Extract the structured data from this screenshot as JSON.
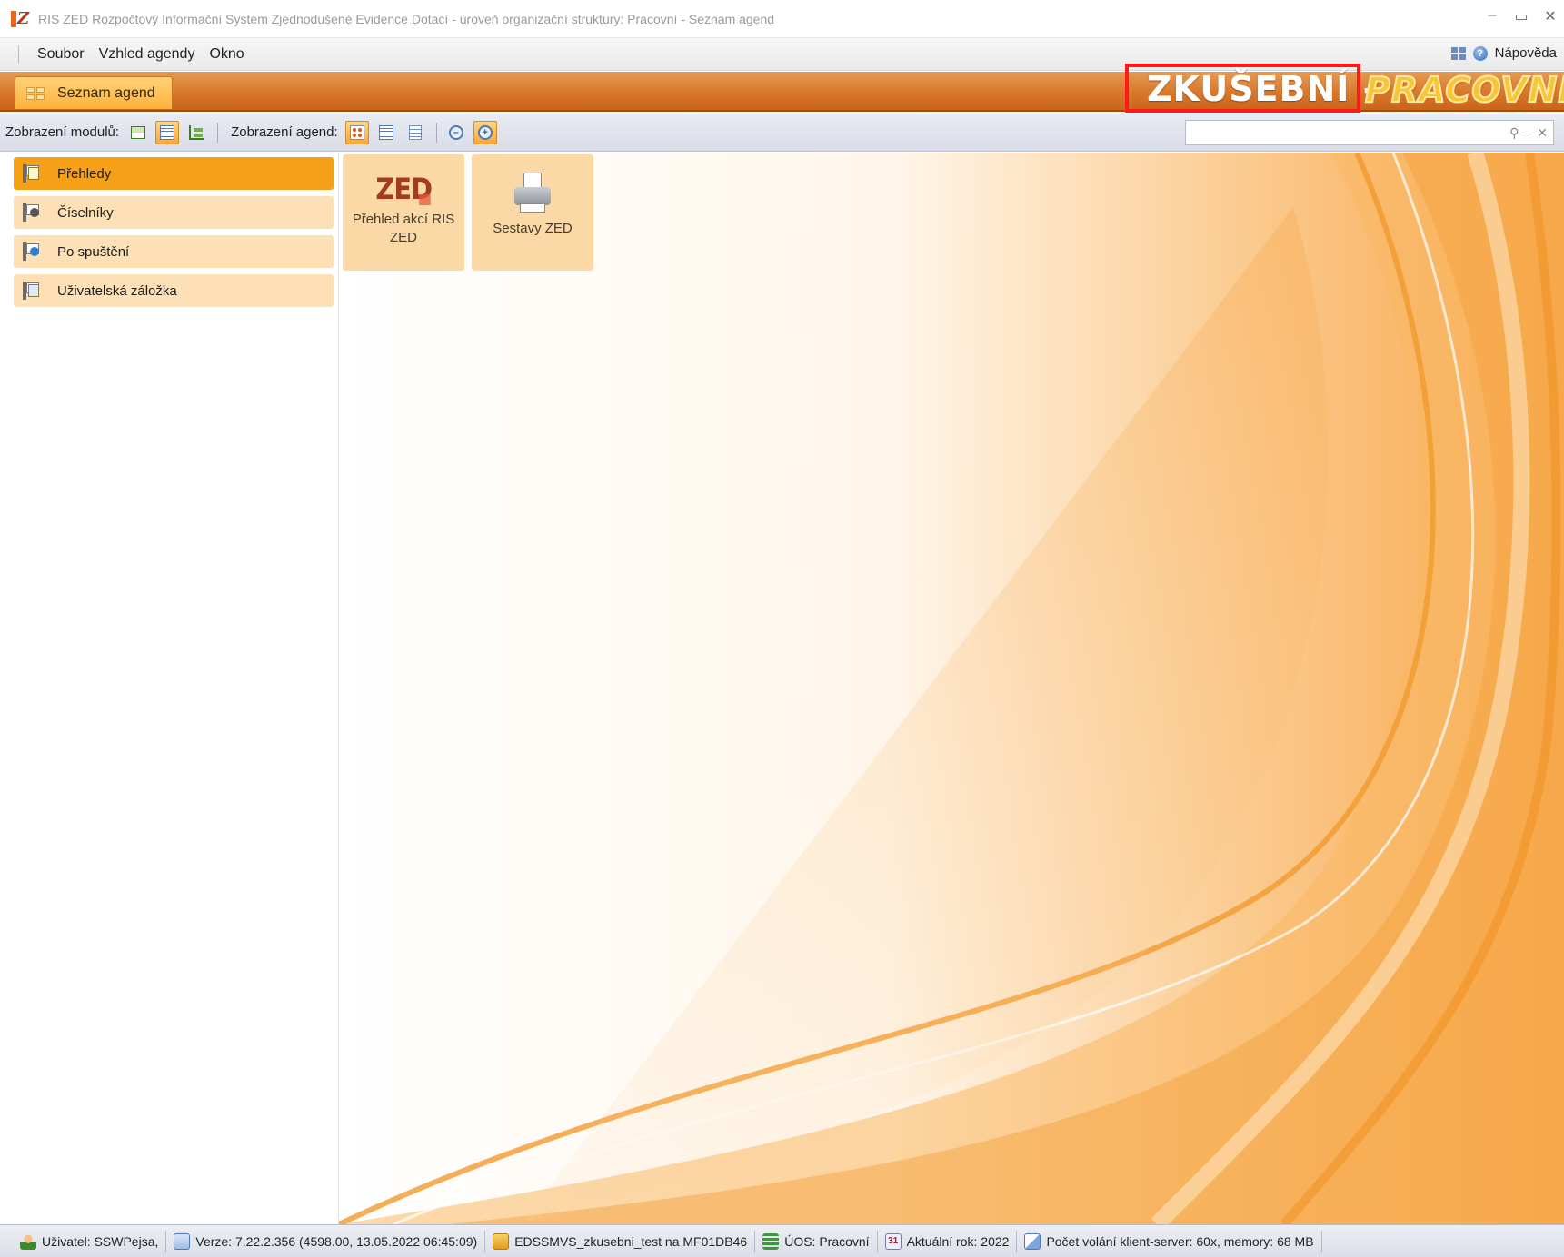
{
  "window": {
    "title": "RIS ZED Rozpočtový Informační Systém Zjednodušené Evidence Dotací - úroveň organizační struktury: Pracovní - Seznam agend",
    "controls": [
      "–",
      "▭",
      "✕"
    ]
  },
  "menu": {
    "items": [
      "Soubor",
      "Vzhled agendy",
      "Okno"
    ],
    "help_label": "Nápověda"
  },
  "tabs": {
    "active_label": "Seznam agend"
  },
  "environment": {
    "label": "ZKUŠEBNÍ -",
    "mode": "PRACOVNÍ",
    "badge_color": "#ff1a1a"
  },
  "toolbar": {
    "modules_label": "Zobrazení modulů:",
    "agendas_label": "Zobrazení agend:",
    "search_value": "",
    "search_clear": "✕",
    "search_minus": "–",
    "zoom_out": "–",
    "zoom_in": "+"
  },
  "sidebar": {
    "items": [
      {
        "label": "Přehledy",
        "icon": "flag-doc-icon",
        "active": true
      },
      {
        "label": "Číselníky",
        "icon": "flag-gear-icon",
        "active": false
      },
      {
        "label": "Po spuštění",
        "icon": "flag-blue-gear-icon",
        "active": false
      },
      {
        "label": "Uživatelská záložka",
        "icon": "flag-user-doc-icon",
        "active": false
      }
    ]
  },
  "tiles": [
    {
      "label": "Přehled akcí RIS ZED",
      "logo": "ZED",
      "icon": "zed-logo-icon"
    },
    {
      "label": "Sestavy ZED",
      "icon": "printer-icon"
    }
  ],
  "status": {
    "user": "Uživatel: SSWPejsa,",
    "version": "Verze: 7.22.2.356 (4598.00, 13.05.2022 06:45:09)",
    "database": "EDSSMVS_zkusebni_test na MF01DB46",
    "uos": "ÚOS: Pracovní",
    "year_icon": "31",
    "year": "Aktuální rok: 2022",
    "calls": "Počet volání klient-server: 60x, memory: 68 MB"
  },
  "colors": {
    "accent_orange": "#f5a016",
    "band_orange": "#d7782c",
    "tile_bg": "#fbd9a6",
    "nav_bg": "#fde0b5"
  }
}
